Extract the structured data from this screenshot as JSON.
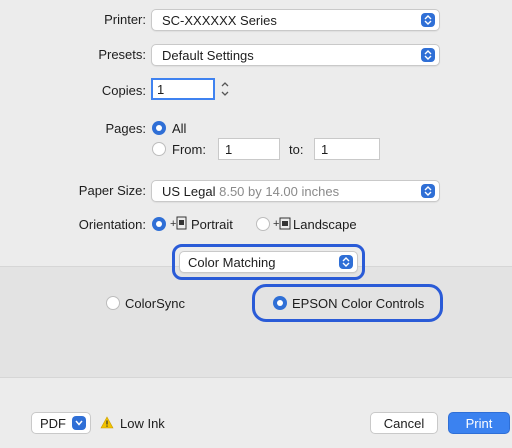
{
  "printer": {
    "label": "Printer:",
    "value": "SC-XXXXXX Series"
  },
  "presets": {
    "label": "Presets:",
    "value": "Default Settings"
  },
  "copies": {
    "label": "Copies:",
    "value": "1"
  },
  "pages": {
    "label": "Pages:",
    "all_label": "All",
    "from_label": "From:",
    "from_value": "1",
    "to_label": "to:",
    "to_value": "1"
  },
  "paper_size": {
    "label": "Paper Size:",
    "value": "US Legal",
    "detail": "8.50 by 14.00 inches"
  },
  "orientation": {
    "label": "Orientation:",
    "portrait": "Portrait",
    "landscape": "Landscape"
  },
  "section": {
    "value": "Color Matching"
  },
  "color_options": {
    "colorsync": "ColorSync",
    "epson": "EPSON Color Controls"
  },
  "footer": {
    "pdf": "PDF",
    "low_ink": "Low Ink",
    "cancel": "Cancel",
    "print": "Print"
  },
  "colors": {
    "accent": "#2f6fd6",
    "highlight": "#2a5bd7",
    "warning": "#f2c200"
  }
}
